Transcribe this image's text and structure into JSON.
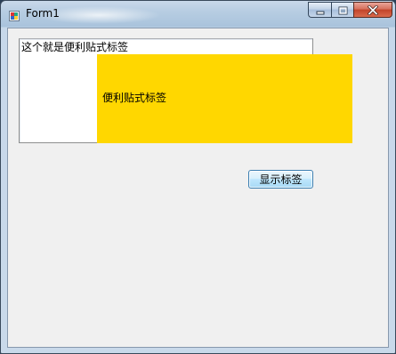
{
  "window": {
    "title": "Form1",
    "caption_buttons": {
      "minimize_icon": "minimize-icon",
      "maximize_icon": "maximize-icon",
      "close_icon": "close-icon"
    }
  },
  "form": {
    "textbox_value": "这个就是便利贴式标签",
    "sticky_label_text": "便利贴式标签",
    "sticky_color": "#ffd700",
    "show_button_label": "显示标签"
  }
}
